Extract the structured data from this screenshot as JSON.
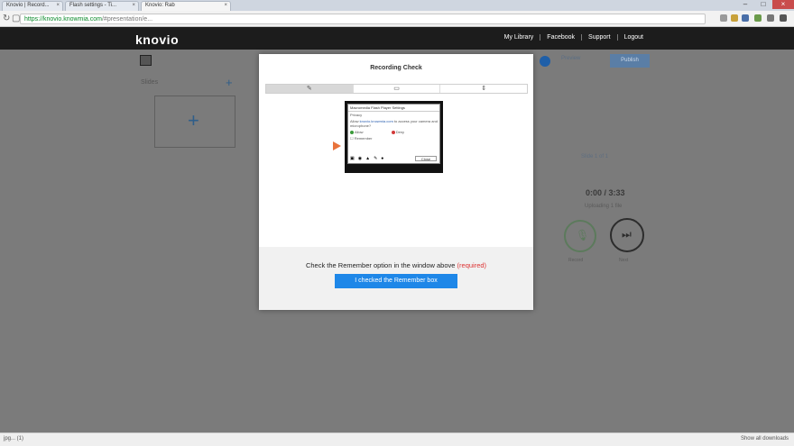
{
  "browser": {
    "tabs": [
      {
        "label": "Knovio | Record..."
      },
      {
        "label": "Flash settings - Ti..."
      },
      {
        "label": "Knovio: Rab"
      }
    ],
    "url_host": "https://knovio.knowmia.com",
    "url_path": "/#presentation/e..."
  },
  "header": {
    "logo": "knovio",
    "nav": [
      "My Library",
      "Facebook",
      "Support",
      "Logout"
    ]
  },
  "workspace": {
    "slides_label": "Slides",
    "add_symbol": "+",
    "ghost_button": "Preview",
    "publish_button": "Publish",
    "faint_label": "Slide 1 of 1",
    "timer": "0:00 / 3:33",
    "timer_sub": "Uploading 1 file",
    "mic_label": "Record",
    "next_label": "Next"
  },
  "modal": {
    "title": "Recording Check",
    "steps": [
      "✎",
      "▭",
      "⇕"
    ],
    "flash": {
      "title": "Macromedia Flash Player Settings",
      "row1": "Privacy",
      "row2_prefix": "Allow ",
      "row2_link": "knovio.knowmia.com",
      "row2_suffix": " to access your camera and microphone?",
      "allow": "Allow",
      "deny": "Deny",
      "remember": "Remember",
      "close": "Close"
    },
    "instruction": "Check the Remember option in the window above",
    "required": "(required)",
    "button": "I checked the Remember box"
  },
  "statusbar": {
    "left": "jpg... (1)",
    "right": "Show all downloads"
  },
  "colors": {
    "accent": "#1e87e8",
    "header_bg": "#1c1c1c",
    "arrow": "#e8733c"
  }
}
